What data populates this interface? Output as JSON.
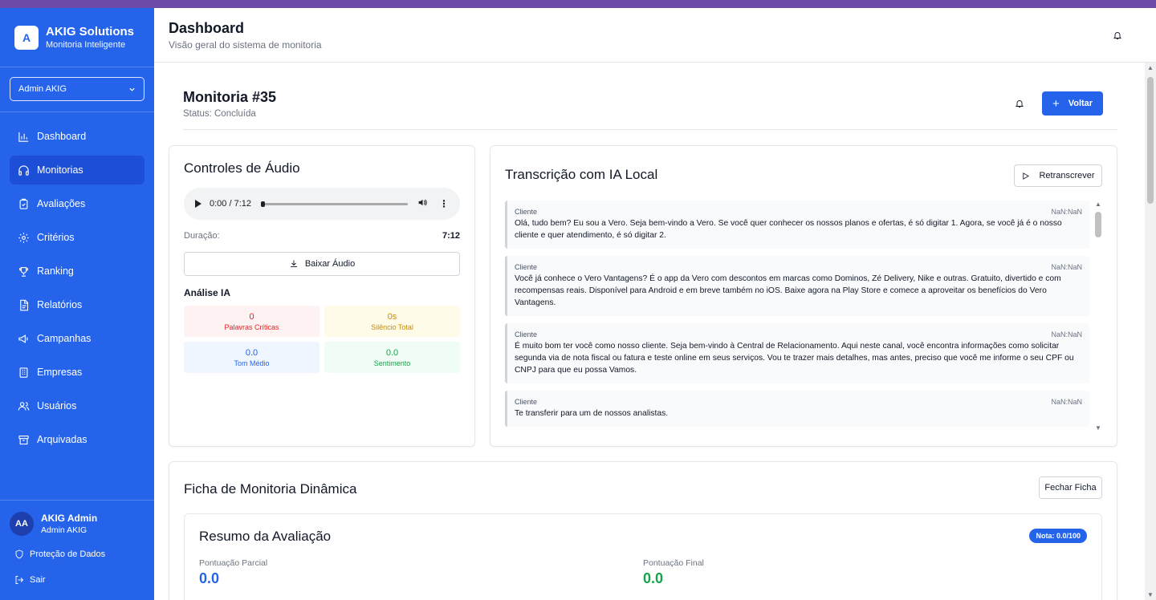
{
  "brand": {
    "logo_letter": "A",
    "name": "AKIG Solutions",
    "subtitle": "Monitoria Inteligente"
  },
  "user_select": {
    "value": "Admin AKIG"
  },
  "nav": [
    {
      "label": "Dashboard",
      "icon": "bar-chart-icon"
    },
    {
      "label": "Monitorias",
      "icon": "headphones-icon",
      "active": true
    },
    {
      "label": "Avaliações",
      "icon": "clipboard-icon"
    },
    {
      "label": "Critérios",
      "icon": "gear-icon"
    },
    {
      "label": "Ranking",
      "icon": "trophy-icon"
    },
    {
      "label": "Relatórios",
      "icon": "document-icon"
    },
    {
      "label": "Campanhas",
      "icon": "megaphone-icon"
    },
    {
      "label": "Empresas",
      "icon": "building-icon"
    },
    {
      "label": "Usuários",
      "icon": "users-icon"
    },
    {
      "label": "Arquivadas",
      "icon": "archive-icon"
    }
  ],
  "sidebar_footer": {
    "avatar_initials": "AA",
    "user_name": "AKIG Admin",
    "user_role": "Admin AKIG",
    "privacy_label": "Proteção de Dados",
    "logout_label": "Sair"
  },
  "header": {
    "title": "Dashboard",
    "subtitle": "Visão geral do sistema de monitoria"
  },
  "monitoria": {
    "title": "Monitoria #35",
    "status": "Status: Concluída",
    "back_label": "Voltar"
  },
  "audio": {
    "title": "Controles de Áudio",
    "player_time": "0:00 / 7:12",
    "duration_label": "Duração:",
    "duration_value": "7:12",
    "download_label": "Baixar Áudio",
    "analysis_title": "Análise IA",
    "metrics": [
      {
        "value": "0",
        "label": "Palavras Críticas",
        "color": "#dc2626"
      },
      {
        "value": "0s",
        "label": "Silêncio Total",
        "color": "#ca8a04"
      },
      {
        "value": "0.0",
        "label": "Tom Médio",
        "color": "#2563eb"
      },
      {
        "value": "0.0",
        "label": "Sentimento",
        "color": "#16a34a"
      }
    ]
  },
  "transcription": {
    "title": "Transcrição com IA Local",
    "retranscribe_label": "Retranscrever",
    "messages": [
      {
        "speaker": "Cliente",
        "time": "NaN:NaN",
        "text": "Olá, tudo bem? Eu sou a Vero. Seja bem-vindo a Vero. Se você quer conhecer os nossos planos e ofertas, é só digitar 1. Agora, se você já é o nosso cliente e quer atendimento, é só digitar 2."
      },
      {
        "speaker": "Cliente",
        "time": "NaN:NaN",
        "text": "Você já conhece o Vero Vantagens? É o app da Vero com descontos em marcas como Dominos, Zé Delivery, Nike e outras. Gratuito, divertido e com recompensas reais. Disponível para Android e em breve também no iOS. Baixe agora na Play Store e comece a aproveitar os benefícios do Vero Vantagens."
      },
      {
        "speaker": "Cliente",
        "time": "NaN:NaN",
        "text": "É muito bom ter você como nosso cliente. Seja bem-vindo à Central de Relacionamento. Aqui neste canal, você encontra informações como solicitar segunda via de nota fiscal ou fatura e teste online em seus serviços. Vou te trazer mais detalhes, mas antes, preciso que você me informe o seu CPF ou CNPJ para que eu possa Vamos."
      },
      {
        "speaker": "Cliente",
        "time": "NaN:NaN",
        "text": "Te transferir para um de nossos analistas."
      }
    ]
  },
  "ficha": {
    "title": "Ficha de Monitoria Dinâmica",
    "close_label": "Fechar Ficha",
    "summary_title": "Resumo da Avaliação",
    "grade_badge": "Nota: 0.0/100",
    "partial_label": "Pontuação Parcial",
    "partial_value": "0.0",
    "final_label": "Pontuação Final",
    "final_value": "0.0"
  },
  "colors": {
    "primary": "#2563eb",
    "sidebar_active": "#1d4ed8",
    "top_stripe": "#6d4aa8"
  }
}
